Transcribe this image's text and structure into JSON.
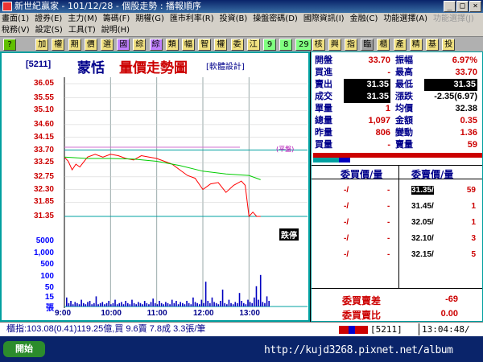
{
  "app": {
    "title": "新世紀贏家 - 101/12/28 - 個股走勢 : 播報順序",
    "win_buttons": [
      "_",
      "□",
      "×"
    ]
  },
  "menu": {
    "row1": [
      "畫面(1)",
      "證券(E)",
      "主力(M)",
      "籌碼(F)",
      "期權(G)",
      "匯市利率(R)",
      "投資(B)",
      "操盤密碼(D)",
      "國際資訊(I)",
      "金融(C)",
      "功能選擇(A)",
      "功能選擇(J)"
    ],
    "row2": [
      "稅務(V)",
      "設定(S)",
      "工具(T)",
      "說明(H)"
    ]
  },
  "toolbar": [
    "?",
    "加",
    "權",
    "期",
    "價",
    "選",
    "國",
    "綜",
    "綜",
    "類",
    "幅",
    "智",
    "權",
    "委",
    "江",
    "9",
    "8",
    "29",
    "核",
    "興",
    "指",
    "臨",
    "櫃",
    "產",
    "精",
    "基",
    "投"
  ],
  "header": {
    "code": "[5211]",
    "name": "蒙恬",
    "title": "量價走勢圖",
    "subtitle": "[軟體設計]"
  },
  "axes": {
    "prices": [
      "36.05",
      "35.55",
      "35.10",
      "34.60",
      "34.15",
      "33.70",
      "33.25",
      "32.75",
      "32.30",
      "31.85",
      "31.35"
    ],
    "volumes": [
      "5000",
      "1,000",
      "500",
      "100",
      "50",
      "15",
      "張"
    ],
    "times": [
      "9:00",
      "10:00",
      "11:00",
      "12:00",
      "13:00"
    ]
  },
  "chart_data": {
    "type": "line",
    "x_range": [
      "9:00",
      "13:30"
    ],
    "ylim": [
      31.35,
      36.05
    ],
    "reference_price": 33.7,
    "limit_down": 31.35,
    "series": [
      {
        "name": "成交",
        "color": "#ff0000",
        "times": [
          "09:00",
          "09:05",
          "09:10",
          "09:15",
          "09:20",
          "09:30",
          "09:40",
          "09:50",
          "10:00",
          "10:10",
          "10:20",
          "10:30",
          "10:40",
          "10:50",
          "11:00",
          "11:10",
          "11:20",
          "11:30",
          "11:40",
          "11:50",
          "12:00",
          "12:10",
          "12:20",
          "12:30",
          "12:40",
          "12:50",
          "12:55",
          "13:00",
          "13:05",
          "13:10",
          "13:15"
        ],
        "values": [
          33.45,
          33.3,
          33.0,
          33.2,
          33.1,
          33.45,
          33.55,
          33.45,
          33.55,
          33.5,
          33.4,
          33.35,
          33.5,
          33.45,
          33.4,
          33.3,
          33.2,
          33.0,
          32.8,
          32.7,
          32.3,
          32.5,
          32.55,
          32.2,
          32.45,
          32.6,
          32.45,
          31.35,
          31.5,
          31.35,
          31.35
        ]
      },
      {
        "name": "均價",
        "color": "#00cc00",
        "times": [
          "09:00",
          "09:30",
          "10:00",
          "10:30",
          "11:00",
          "11:30",
          "12:00",
          "12:30",
          "13:00",
          "13:15"
        ],
        "values": [
          33.45,
          33.4,
          33.4,
          33.38,
          33.3,
          33.15,
          32.95,
          32.85,
          32.8,
          32.65
        ]
      }
    ],
    "volume": [
      8,
      3,
      5,
      2,
      4,
      3,
      2,
      6,
      3,
      2,
      4,
      5,
      2,
      3,
      9,
      2,
      3,
      4,
      2,
      3,
      5,
      2,
      3,
      6,
      2,
      3,
      4,
      2,
      5,
      3,
      2,
      6,
      3,
      2,
      4,
      3,
      2,
      5,
      3,
      2,
      4,
      7,
      3,
      2,
      5,
      3,
      2,
      4,
      3,
      2,
      6,
      3,
      5,
      2,
      4,
      3,
      2,
      5,
      3,
      2,
      8,
      4,
      3,
      2,
      6,
      3,
      22,
      5,
      3,
      8,
      4,
      3,
      2,
      5,
      15,
      3,
      2,
      6,
      3,
      2,
      4,
      3,
      12,
      5,
      3,
      2,
      6,
      4,
      3,
      8,
      18,
      6,
      28,
      4,
      3,
      9,
      5
    ]
  },
  "marker": {
    "ref": "(平盤)",
    "limit": "跌停"
  },
  "quote": [
    {
      "l1": "開盤",
      "v1": "33.70",
      "l2": "振幅",
      "v2": "6.97%"
    },
    {
      "l1": "買進",
      "v1": "-",
      "l2": "最高",
      "v2": "33.70"
    },
    {
      "l1": "賣出",
      "v1": "31.35",
      "l2": "最低",
      "v2": "31.35"
    },
    {
      "l1": "成交",
      "v1": "31.35",
      "l2": "漲跌",
      "v2": "-2.35(6.97)"
    },
    {
      "l1": "單量",
      "v1": "1",
      "l2": "均價",
      "v2": "32.38"
    },
    {
      "l1": "總量",
      "v1": "1,097",
      "l2": "金額",
      "v2": "0.35"
    },
    {
      "l1": "昨量",
      "v1": "806",
      "l2": "變動",
      "v2": "1.36"
    },
    {
      "l1": "買量",
      "v1": "-",
      "l2": "賣量",
      "v2": "59"
    }
  ],
  "orderbook": {
    "bid_header": "委買價/量",
    "ask_header": "委賣價/量",
    "rows": [
      {
        "bp": "-/",
        "bv": "-",
        "ap": "31.35/",
        "av": "59"
      },
      {
        "bp": "-/",
        "bv": "-",
        "ap": "31.45/",
        "av": "1"
      },
      {
        "bp": "-/",
        "bv": "-",
        "ap": "32.05/",
        "av": "1"
      },
      {
        "bp": "-/",
        "bv": "-",
        "ap": "32.10/",
        "av": "3"
      },
      {
        "bp": "-/",
        "bv": "-",
        "ap": "32.15/",
        "av": "5"
      }
    ],
    "diff_label": "委買賣差",
    "diff_val": "-69",
    "ratio_label": "委買賣比",
    "ratio_val": "0.00"
  },
  "status": {
    "index_text": "櫃指:103.08(0.41)119.25億,買 9.6賣 7.8成 3.3張/筆",
    "code": "5211",
    "time": "13:04:48/"
  },
  "taskbar": {
    "url": "http://kujd3268.pixnet.net/album",
    "start": "開始"
  }
}
